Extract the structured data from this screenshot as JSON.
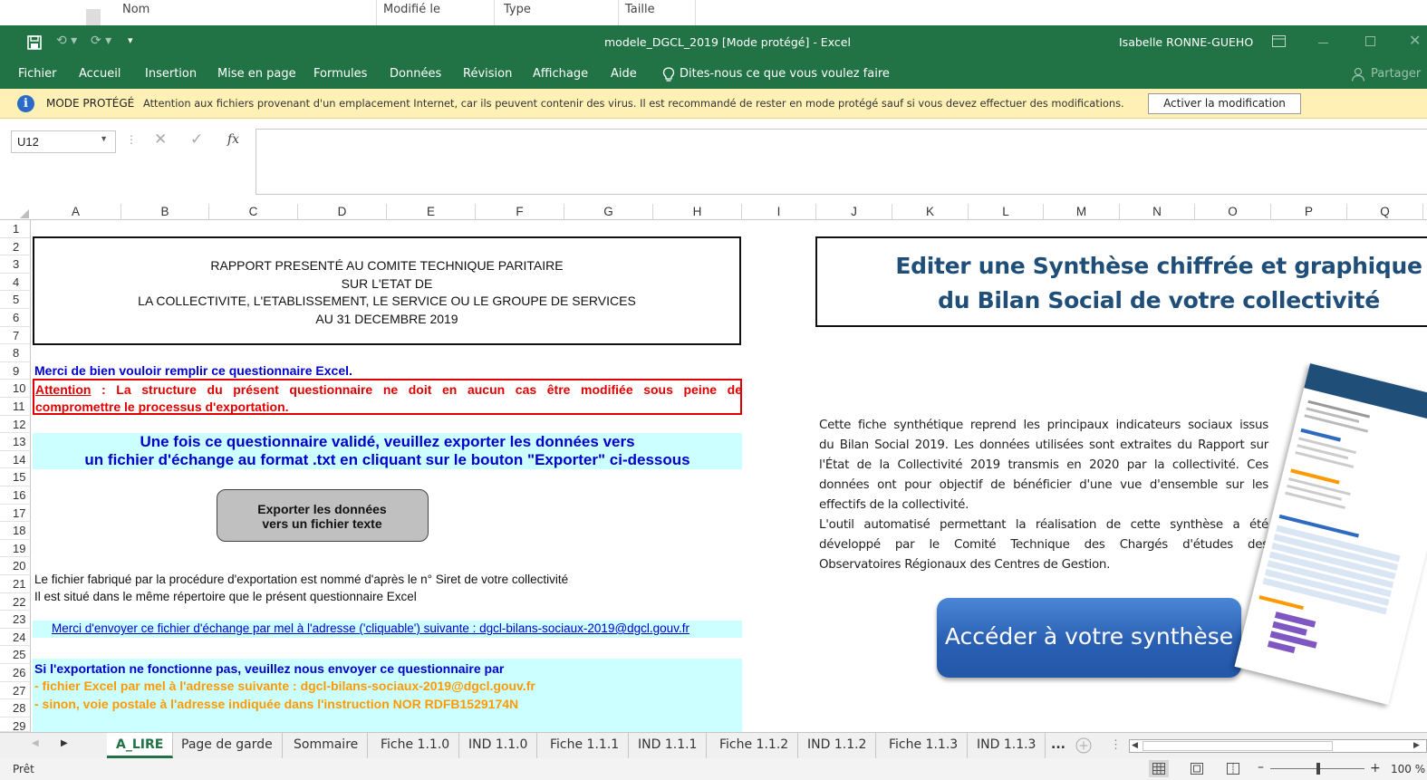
{
  "explorer_header": {
    "nom": "Nom",
    "modifie": "Modifié le",
    "type": "Type",
    "taille": "Taille"
  },
  "window": {
    "title": "modele_DGCL_2019 [Mode protégé] - Excel",
    "user": "Isabelle RONNE-GUEHO",
    "share": "Partager"
  },
  "ribbon_tabs": [
    "Fichier",
    "Accueil",
    "Insertion",
    "Mise en page",
    "Formules",
    "Données",
    "Révision",
    "Affichage",
    "Aide"
  ],
  "tell_me": "Dites-nous ce que vous voulez faire",
  "protected": {
    "label": "MODE PROTÉGÉ",
    "message": "Attention aux fichiers provenant d'un emplacement Internet, car ils peuvent contenir des virus. Il est recommandé de rester en mode protégé sauf si vous devez effectuer des modifications.",
    "button": "Activer la modification"
  },
  "formula_bar": {
    "cell_ref": "U12",
    "fx": "fx",
    "formula": ""
  },
  "columns": [
    "A",
    "B",
    "C",
    "D",
    "E",
    "F",
    "G",
    "H",
    "I",
    "J",
    "K",
    "L",
    "M",
    "N",
    "O",
    "P",
    "Q"
  ],
  "rows": [
    "1",
    "2",
    "3",
    "4",
    "5",
    "6",
    "7",
    "8",
    "9",
    "10",
    "11",
    "12",
    "13",
    "14",
    "15",
    "16",
    "17",
    "18",
    "19",
    "20",
    "21",
    "22",
    "23",
    "24",
    "25",
    "26",
    "27",
    "28",
    "29"
  ],
  "sheet": {
    "report_title": [
      "RAPPORT PRESENTÉ AU COMITE TECHNIQUE PARITAIRE",
      "SUR L'ETAT  DE",
      "LA COLLECTIVITE, L'ETABLISSEMENT, LE SERVICE OU LE GROUPE DE SERVICES",
      "AU 31 DECEMBRE 2019"
    ],
    "merci": "Merci de bien vouloir remplir ce questionnaire Excel.",
    "attention_word": "Attention",
    "attention_rest": " : La structure du présent questionnaire ne doit en aucun cas être modifiée sous peine de",
    "attention_line2": "compromettre le processus d'exportation.",
    "export_line1": "Une fois ce questionnaire validé, veuillez exporter les données vers",
    "export_line2": "un fichier d'échange au format .txt en cliquant sur le bouton \"Exporter\" ci-dessous",
    "export_button": [
      "Exporter les données",
      "vers un fichier texte"
    ],
    "info21": "Le fichier fabriqué par la procédure d'exportation est nommé d'après le n° Siret de votre collectivité",
    "info22": "Il est situé dans le même répertoire que le présent questionnaire Excel",
    "mail_line": "Merci d'envoyer ce fichier d'échange par mel à l'adresse ('cliquable') suivante : dgcl-bilans-sociaux-2019@dgcl.gouv.fr",
    "fallback_title": "Si l'exportation ne fonctionne pas, veuillez nous envoyer ce questionnaire par",
    "fallback_1": "- fichier Excel par mel à l'adresse suivante : dgcl-bilans-sociaux-2019@dgcl.gouv.fr",
    "fallback_2": "- sinon, voie postale à l'adresse indiquée dans l'instruction NOR RDFB1529174N",
    "synth_title": [
      "Editer une Synthèse chiffrée et graphique",
      "du Bilan Social de votre collectivité"
    ],
    "synth_text": [
      "Cette fiche synthétique reprend les principaux indicateurs sociaux issus",
      "du Bilan Social 2019. Les données utilisées sont extraites du Rapport sur",
      "l'État de la Collectivité 2019 transmis en 2020 par la collectivité. Ces",
      "données ont pour objectif de bénéficier d'une vue d'ensemble sur les",
      "effectifs de la collectivité.",
      "L'outil automatisé permettant la réalisation de cette synthèse a été",
      "développé par le Comité Technique des Chargés d'études des",
      "Observatoires Régionaux des Centres de Gestion."
    ],
    "synth_button": "Accéder à votre synthèse"
  },
  "sheet_tabs": [
    "A_LIRE",
    "Page de garde",
    "Sommaire",
    "Fiche 1.1.0",
    "IND 1.1.0",
    "Fiche 1.1.1",
    "IND 1.1.1",
    "Fiche 1.1.2",
    "IND 1.1.2",
    "Fiche 1.1.3",
    "IND 1.1.3",
    "..."
  ],
  "status": {
    "ready": "Prêt",
    "zoom": "100 %"
  },
  "colors": {
    "excel_green": "#217346",
    "protected_bg": "#fff1b5",
    "cyan_band": "#ccffff",
    "synth_blue": "#1f4e79",
    "button_blue": "#2e6bc0"
  }
}
